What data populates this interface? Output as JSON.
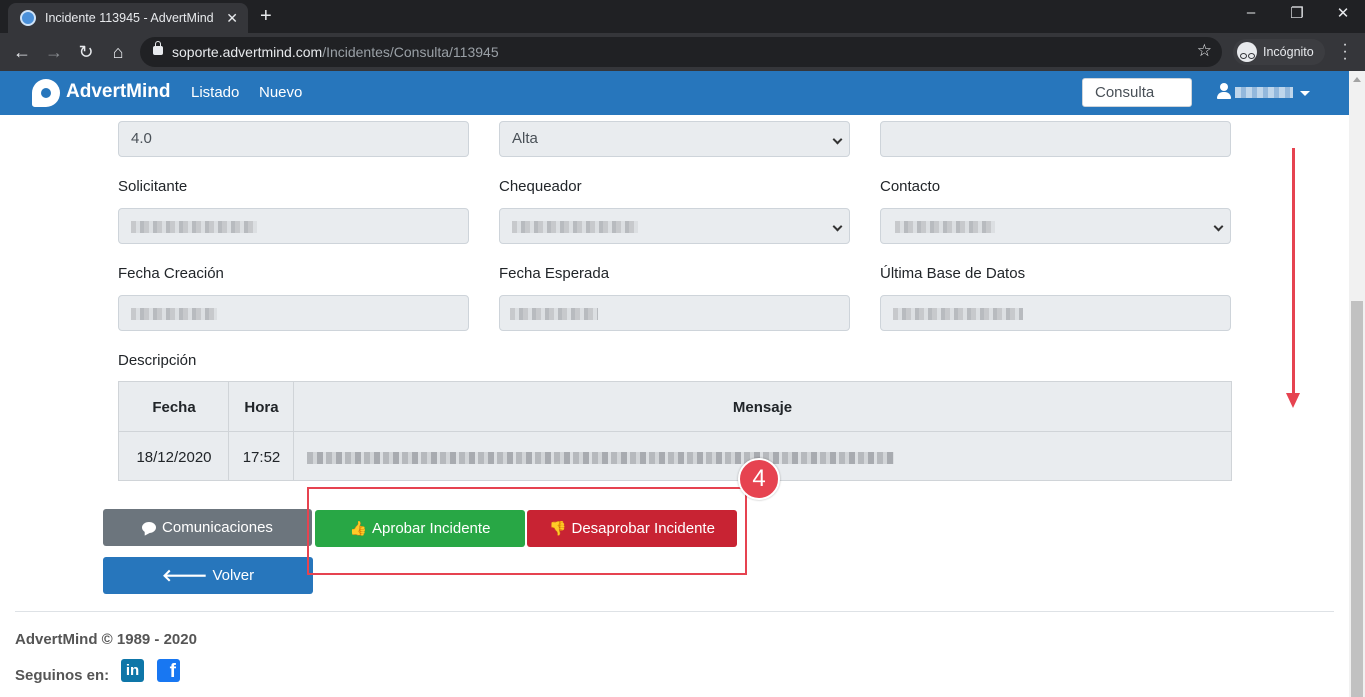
{
  "browser": {
    "tab_title": "Incidente 113945 - AdvertMind In",
    "new_tab": "+",
    "url_host": "soporte.advertmind.com",
    "url_path": "/Incidentes/Consulta/113945",
    "incognito_label": "Incógnito"
  },
  "navbar": {
    "brand": "AdvertMind",
    "links": [
      "Listado",
      "Nuevo"
    ],
    "search_value": "Consulta"
  },
  "form": {
    "row1": {
      "version": "4.0",
      "priority": "Alta"
    },
    "labels": {
      "solicitante": "Solicitante",
      "chequeador": "Chequeador",
      "contacto": "Contacto",
      "fecha_creacion": "Fecha Creación",
      "fecha_esperada": "Fecha Esperada",
      "ultima_base": "Última Base de Datos",
      "descripcion": "Descripción"
    }
  },
  "table": {
    "headers": [
      "Fecha",
      "Hora",
      "Mensaje"
    ],
    "rows": [
      {
        "fecha": "18/12/2020",
        "hora": "17:52"
      }
    ]
  },
  "buttons": {
    "comunicaciones": "Comunicaciones",
    "aprobar": "Aprobar Incidente",
    "desaprobar": "Desaprobar Incidente",
    "volver": "Volver"
  },
  "annotation": {
    "step": "4",
    "color": "#e64350"
  },
  "footer": {
    "copyright": "AdvertMind © 1989 - 2020",
    "follow": "Seguinos en:",
    "linkedin": "in",
    "facebook": "f"
  },
  "colors": {
    "navbar": "#2776bc",
    "approve": "#28a745",
    "reject": "#c82333",
    "secondary": "#6c757d"
  }
}
